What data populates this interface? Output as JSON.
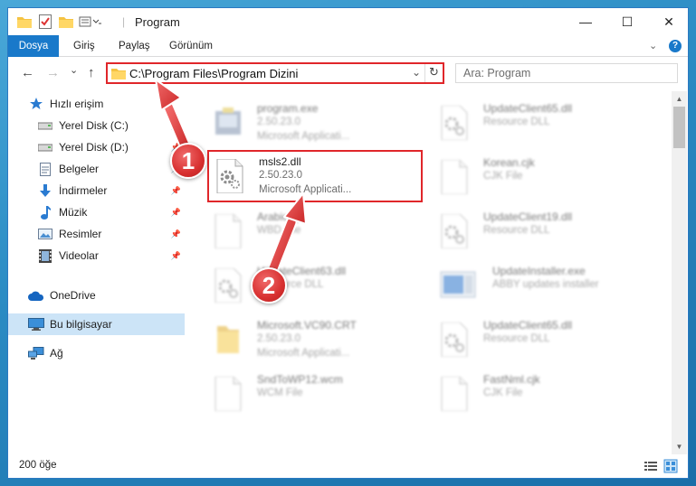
{
  "window": {
    "title": "Program",
    "controls": {
      "minimize": "—",
      "maximize": "☐",
      "close": "✕"
    }
  },
  "ribbon": {
    "tabs": [
      {
        "label": "Dosya",
        "active": true
      },
      {
        "label": "Giriş",
        "active": false
      },
      {
        "label": "Paylaş",
        "active": false
      },
      {
        "label": "Görünüm",
        "active": false
      }
    ],
    "expand_icon": "chevron-down-icon",
    "help_icon": "help-icon"
  },
  "nav": {
    "back": "←",
    "forward": "→",
    "recent": "⌄",
    "up": "↑",
    "address": "C:\\Program Files\\Program Dizini",
    "search_placeholder": "Ara: Program"
  },
  "sidebar": {
    "items": [
      {
        "label": "Hızlı erişim",
        "icon": "star-icon",
        "pinned": false
      },
      {
        "label": "Yerel Disk (C:)",
        "icon": "disk-icon",
        "pinned": true
      },
      {
        "label": "Yerel Disk (D:)",
        "icon": "disk-icon",
        "pinned": true
      },
      {
        "label": "Belgeler",
        "icon": "document-icon",
        "pinned": true
      },
      {
        "label": "İndirmeler",
        "icon": "download-icon",
        "pinned": true
      },
      {
        "label": "Müzik",
        "icon": "music-icon",
        "pinned": true
      },
      {
        "label": "Resimler",
        "icon": "pictures-icon",
        "pinned": true
      },
      {
        "label": "Videolar",
        "icon": "video-icon",
        "pinned": true
      },
      {
        "label": "OneDrive",
        "icon": "cloud-icon",
        "pinned": false
      },
      {
        "label": "Bu bilgisayar",
        "icon": "computer-icon",
        "pinned": false,
        "selected": true
      },
      {
        "label": "Ağ",
        "icon": "network-icon",
        "pinned": false
      }
    ]
  },
  "files": {
    "left": [
      {
        "name": "program.exe",
        "line2": "2.50.23.0",
        "line3": "Microsoft Applicati...",
        "icon": "exe-icon",
        "blurred": true
      },
      {
        "name": "msls2.dll",
        "line2": "2.50.23.0",
        "line3": "Microsoft Applicati...",
        "icon": "dll-gear-icon",
        "blurred": false,
        "highlighted": true
      },
      {
        "name": "Arabic.cjk",
        "line2": "WBD File",
        "line3": "",
        "icon": "blank-file-icon",
        "blurred": true
      },
      {
        "name": "UpdateClient63.dll",
        "line2": "Resource DLL",
        "line3": "",
        "icon": "dll-gear-icon",
        "blurred": true
      },
      {
        "name": "Microsoft.VC90.CRT",
        "line2": "2.50.23.0",
        "line3": "Microsoft Applicati...",
        "icon": "folder-icon",
        "blurred": true
      },
      {
        "name": "SndToWP12.wcm",
        "line2": "WCM File",
        "line3": "",
        "icon": "blank-file-icon",
        "blurred": true
      }
    ],
    "right": [
      {
        "name": "UpdateClient65.dll",
        "line2": "Resource DLL",
        "line3": "",
        "icon": "dll-gear-icon",
        "blurred": true
      },
      {
        "name": "Korean.cjk",
        "line2": "CJK File",
        "line3": "",
        "icon": "blank-file-icon",
        "blurred": true
      },
      {
        "name": "UpdateClient19.dll",
        "line2": "Resource DLL",
        "line3": "",
        "icon": "dll-gear-icon",
        "blurred": true
      },
      {
        "name": "UpdateInstaller.exe",
        "line2": "ABBY updates installer",
        "line3": "",
        "icon": "installer-icon",
        "blurred": true
      },
      {
        "name": "UpdateClient65.dll",
        "line2": "Resource DLL",
        "line3": "",
        "icon": "dll-gear-icon",
        "blurred": true
      },
      {
        "name": "FastNml.cjk",
        "line2": "CJK File",
        "line3": "",
        "icon": "blank-file-icon",
        "blurred": true
      }
    ]
  },
  "status": {
    "count": "200 öğe"
  },
  "annotations": {
    "badge1": "1",
    "badge2": "2",
    "color": "#e0262a"
  }
}
